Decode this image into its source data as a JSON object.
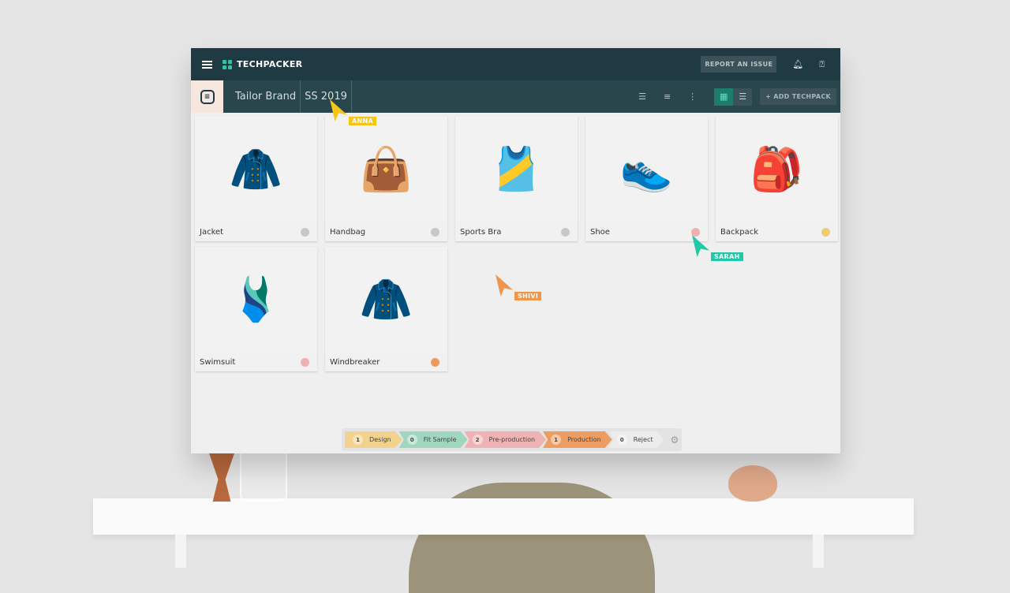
{
  "app": {
    "brand": "TECHPACKER",
    "report_label": "REPORT AN ISSUE",
    "icons": [
      "menu-icon",
      "bell-icon",
      "help-icon"
    ]
  },
  "breadcrumb": [
    "Tailor Brand",
    "SS 2019"
  ],
  "toolbar": {
    "add_label": "ADD TECHPACK",
    "view": "grid"
  },
  "cards": [
    {
      "label": "Jacket",
      "status_color": "#c8c8c8"
    },
    {
      "label": "Handbag",
      "status_color": "#c8c8c8"
    },
    {
      "label": "Sports Bra",
      "status_color": "#c8c8c8"
    },
    {
      "label": "Shoe",
      "status_color": "#eeb1b1"
    },
    {
      "label": "Backpack",
      "status_color": "#f0cb74"
    },
    {
      "label": "Swimsuit",
      "status_color": "#eeb1b1"
    },
    {
      "label": "Windbreaker",
      "status_color": "#ee9a5c"
    }
  ],
  "stages": [
    {
      "count": "1",
      "label": "Design",
      "color": "#f2d28c"
    },
    {
      "count": "0",
      "label": "Fit Sample",
      "color": "#9fd6bd"
    },
    {
      "count": "2",
      "label": "Pre-production",
      "color": "#efb3b3"
    },
    {
      "count": "1",
      "label": "Production",
      "color": "#ee9d62"
    },
    {
      "count": "0",
      "label": "Reject",
      "color": "#ececec"
    }
  ],
  "cursors": [
    {
      "name": "ANNA",
      "color": "#f5c518"
    },
    {
      "name": "SARAH",
      "color": "#1fc9a5"
    },
    {
      "name": "SHIVI",
      "color": "#f0954c"
    }
  ]
}
